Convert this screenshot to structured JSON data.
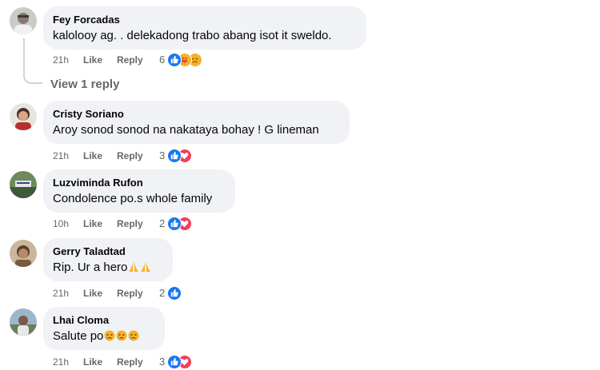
{
  "comments": [
    {
      "author": "Fey Forcadas",
      "text": "kalolooy ag. . delekadong trabo abang isot it sweldo.",
      "time": "21h",
      "like": "Like",
      "reply": "Reply",
      "reaction_count": "6",
      "reactions": [
        "like-icon",
        "care-icon",
        "sad-icon"
      ]
    },
    {
      "author": "Cristy Soriano",
      "text": "Aroy sonod sonod na nakataya bohay ! G lineman",
      "time": "21h",
      "like": "Like",
      "reply": "Reply",
      "reaction_count": "3",
      "reactions": [
        "like-icon",
        "love-icon"
      ]
    },
    {
      "author": "Luzviminda Rufon",
      "text": "Condolence po.s whole family",
      "time": "10h",
      "like": "Like",
      "reply": "Reply",
      "reaction_count": "2",
      "reactions": [
        "like-icon",
        "love-icon"
      ]
    },
    {
      "author": "Gerry Taladtad",
      "text": "Rip. Ur a hero",
      "text_emojis": [
        "folded-hands-emoji",
        "folded-hands-emoji"
      ],
      "time": "21h",
      "like": "Like",
      "reply": "Reply",
      "reaction_count": "2",
      "reactions": [
        "like-icon"
      ]
    },
    {
      "author": "Lhai Cloma",
      "text": "Salute po",
      "text_emojis": [
        "crying-face-emoji",
        "crying-face-emoji",
        "crying-face-emoji"
      ],
      "time": "21h",
      "like": "Like",
      "reply": "Reply",
      "reaction_count": "3",
      "reactions": [
        "like-icon",
        "love-icon"
      ]
    }
  ],
  "view_replies": "View 1 reply",
  "colors": {
    "like_blue": "#1877f2",
    "love_red": "#f33e58",
    "sad_yellow": "#f7b125",
    "bubble_bg": "#f0f2f5",
    "meta_gray": "#65676b"
  }
}
